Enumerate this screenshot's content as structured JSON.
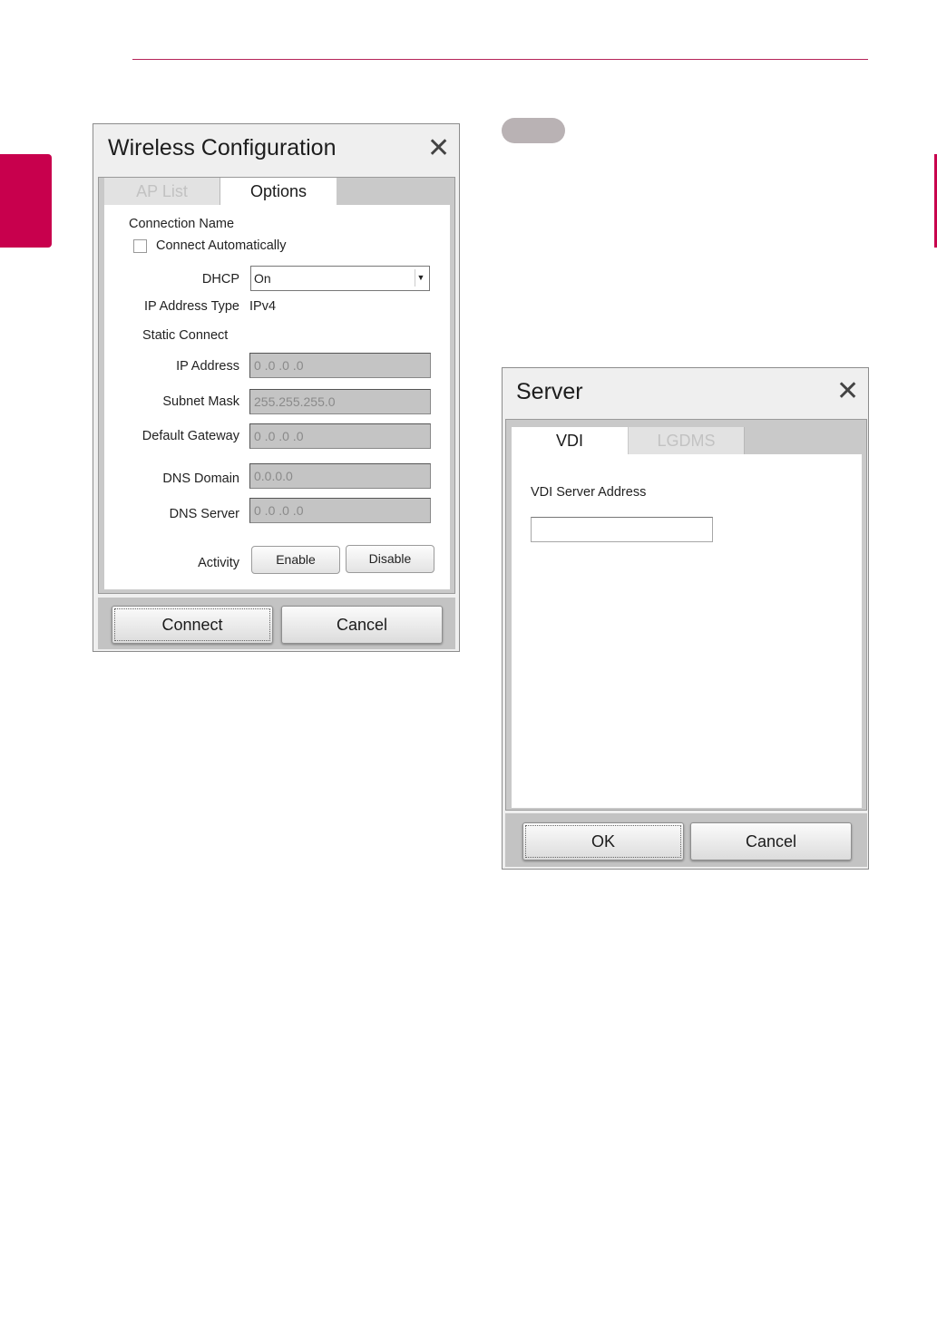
{
  "wireless": {
    "title": "Wireless Configuration",
    "close_glyph": "✕",
    "tabs": [
      {
        "label": "AP List",
        "active": false
      },
      {
        "label": "Options",
        "active": true
      }
    ],
    "connection_name_label": "Connection Name",
    "connect_auto_label": "Connect Automatically",
    "dhcp_label": "DHCP",
    "dhcp_value": "On",
    "ip_type_label": "IP Address Type",
    "ip_type_value": "IPv4",
    "static_connect_label": "Static Connect",
    "fields": {
      "ip_address": {
        "label": "IP Address",
        "value": "0  .0  .0  .0"
      },
      "subnet_mask": {
        "label": "Subnet Mask",
        "value": "255.255.255.0"
      },
      "default_gateway": {
        "label": "Default Gateway",
        "value": "0  .0  .0  .0"
      },
      "dns_domain": {
        "label": "DNS Domain",
        "value": "0.0.0.0"
      },
      "dns_server": {
        "label": "DNS Server",
        "value": "0  .0  .0  .0"
      }
    },
    "activity_label": "Activity",
    "enable_label": "Enable",
    "disable_label": "Disable",
    "connect_label": "Connect",
    "cancel_label": "Cancel"
  },
  "server": {
    "title": "Server",
    "close_glyph": "✕",
    "tabs": [
      {
        "label": "VDI",
        "active": true
      },
      {
        "label": "LGDMS",
        "active": false
      }
    ],
    "vdi_address_label": "VDI Server Address",
    "vdi_address_value": "",
    "ok_label": "OK",
    "cancel_label": "Cancel"
  },
  "colors": {
    "accent": "#c8004d",
    "rule": "#b5245a",
    "note_pill": "#b9b2b4"
  }
}
